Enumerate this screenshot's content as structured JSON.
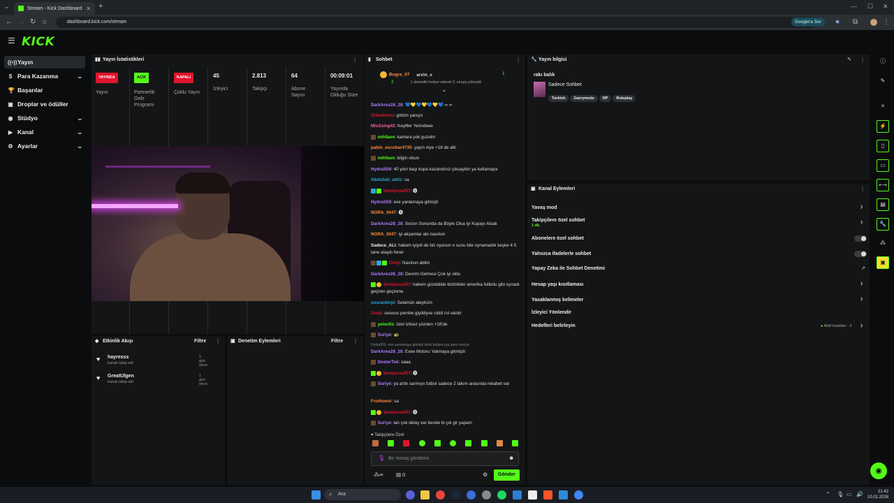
{
  "browser": {
    "tab_title": "Stream - Kick Dashboard",
    "url": "dashboard.kick.com/stream",
    "google_sor": "Google'a Sor"
  },
  "app": {
    "logo": "KICK"
  },
  "sidebar": {
    "items": [
      {
        "label": "Yayın",
        "icon": "broadcast-icon"
      },
      {
        "label": "Para Kazanma",
        "icon": "money-icon"
      },
      {
        "label": "Başarılar",
        "icon": "trophy-icon"
      },
      {
        "label": "Droplar ve ödüller",
        "icon": "gift-icon"
      },
      {
        "label": "Stüdyo",
        "icon": "studio-icon"
      },
      {
        "label": "Kanal",
        "icon": "channel-icon"
      },
      {
        "label": "Ayarlar",
        "icon": "gear-icon"
      }
    ]
  },
  "stats": {
    "title": "Yayın İstatistikleri",
    "items": [
      {
        "badge": "YAYINDA",
        "label": "Yayın"
      },
      {
        "badge": "AÇIK",
        "label": "Partnerlik Gelir Programı"
      },
      {
        "badge": "KAPALI",
        "label": "Çoklu Yayın"
      },
      {
        "value": "45",
        "label": "İzleyici"
      },
      {
        "value": "2.813",
        "label": "Takipçi"
      },
      {
        "value": "64",
        "label": "Abone Sayısı"
      },
      {
        "value": "00:09:01",
        "label": "Yayında Olduğu Süre"
      }
    ]
  },
  "activity": {
    "title": "Etkinlik Akışı",
    "filter": "Filtre",
    "items": [
      {
        "name": "hayresss",
        "sub": "kanalı takip etti",
        "time": "1 gün önce"
      },
      {
        "name": "GreatUlgen",
        "sub": "kanalı takip etti",
        "time": "1 gün önce"
      }
    ]
  },
  "moderation": {
    "title": "Denetim Eylemleri",
    "filter": "Filtre"
  },
  "chat": {
    "title": "Sohbet",
    "pinned_user1": "Bugra_07",
    "pinned_count1": "2",
    "pinned_user2": "arvin_x",
    "pinned_count2": "1",
    "pinned_note": "1 abonelik hediye ederek 3. sıraya yükseldi",
    "messages": [
      {
        "user": "DarkAres28_28",
        "color": "#b07cff",
        "text": "💙💛💙💛💙💛💙 ∞ ∞"
      },
      {
        "user": "Orbodorbu",
        "color": "#e0142e",
        "text": "götüm yanıyo"
      },
      {
        "user": "MisSsing42",
        "color": "#ff5ca8",
        "text": "Keyifler Yerindeee"
      },
      {
        "user": "mihfaon",
        "color": "#53fc18",
        "text": "kamera yok guzelm"
      },
      {
        "user": "pablo_escobar4735",
        "color": "#ff8a3c",
        "text": "yayın niye +18 de abi"
      },
      {
        "user": "mihfaon",
        "color": "#53fc18",
        "text": "bilgin olsun"
      },
      {
        "user": "HydraS59",
        "color": "#b07cff",
        "text": "40 yılın başı kupa kazandınız çıksaydın ya kutlamaya"
      },
      {
        "user": "Abdullah_abiiz",
        "color": "#2aa8d8",
        "text": "sa"
      },
      {
        "user": "Semiyusuf57",
        "color": "#e0142e",
        "text": "🅢"
      },
      {
        "user": "HydraS59",
        "color": "#b07cff",
        "text": "exe yanlamaya gitmişti"
      },
      {
        "user": "NORA_0047",
        "color": "#ff8a3c",
        "text": "🅢"
      },
      {
        "user": "DarkAres28_28",
        "color": "#b07cff",
        "text": "Sezon Sonunda da Böyle Olsa iyi Kupayı Alsak"
      },
      {
        "user": "NORA_0047",
        "color": "#ff8a3c",
        "text": "iyi akşamlar abi nasılsın"
      },
      {
        "user": "Sadece_ALI",
        "color": "#eeeeee",
        "text": "hakem iyiydi de biz oyunun o sunu bile oynamadık keşke 4 5 tane ataydı fener"
      },
      {
        "user": "Gneji",
        "color": "#e0142e",
        "text": "Nasılsın ablim"
      },
      {
        "user": "DarkAres28_28",
        "color": "#b07cff",
        "text": "Devrim Gelmesi Çok iyi oldu"
      },
      {
        "user": "Semiyusuf57",
        "color": "#e0142e",
        "text": "hakem güzeldide bizimkiler amerika futbolu gibi oynadı geçiren geçirene"
      },
      {
        "user": "osurankirpi",
        "color": "#2aa8d8",
        "text": "Selamün aleyküm"
      },
      {
        "user": "Gneji",
        "color": "#e0142e",
        "text": "oooooo pembe giyildiyse ciddi rol vardır"
      },
      {
        "user": "yeisnfiz",
        "color": "#53fc18",
        "text": "özel izlicez yüzden +18'de"
      },
      {
        "user": "Suriye",
        "color": "#b07cff",
        "text": "🐢"
      },
      {
        "user": "DarkAres28_28",
        "color": "#b07cff",
        "text": "Exee Motoru Yakmaya gitmiştir"
      },
      {
        "user": "DexterTek",
        "color": "#b07cff",
        "text": "saaa"
      },
      {
        "user": "Semiyusuf57",
        "color": "#e0142e",
        "text": "🅢"
      },
      {
        "user": "Suriye",
        "color": "#b07cff",
        "text": "ya artık sarmıyo futbol sadece 2 takım arasında rekabet var"
      },
      {
        "user": "Frothomir",
        "color": "#ff8a3c",
        "text": "sa"
      },
      {
        "user": "Semiyusuf57",
        "color": "#e0142e",
        "text": "🅢"
      },
      {
        "user": "Suriye",
        "color": "#b07cff",
        "text": "lan çok delay var bende bi çık gir yapam"
      }
    ],
    "reply_note": "Hydra559: exe yanlamaya gitmişti isimli kullanıcıya yanıt veriyor",
    "followers_only": "Takipçilere Özel",
    "input_placeholder": "Bir mesaj gönderin",
    "points": "0",
    "send": "Gönder"
  },
  "stream_info": {
    "title": "Yayın bilgisi",
    "stream_title": "rakı balık",
    "category": "Sadece Sohbet",
    "tags": [
      "Turkish",
      "Garrymods",
      "RP",
      "Roleplay"
    ]
  },
  "channel_actions": {
    "title": "Kanal Eylemleri",
    "items": [
      {
        "label": "Yavaş mod",
        "type": "chevron"
      },
      {
        "label": "Takipçilere özel sohbet",
        "sub": "1 dk.",
        "type": "chevron"
      },
      {
        "label": "Abonelere özel sohbet",
        "type": "toggle"
      },
      {
        "label": "Yalnızca ifadelerle sohbet",
        "type": "toggle"
      },
      {
        "label": "Yapay Zeka ile Sohbet Denetimi",
        "type": "external"
      },
      {
        "label": "Hesap yaşı kısıtlaması",
        "type": "chevron"
      },
      {
        "label": "Yasaklanmış kelimeler",
        "type": "chevron"
      },
      {
        "label": "İzleyici Yönlendir",
        "type": "none"
      },
      {
        "label": "Hedefleri belirleyin",
        "type": "chevron",
        "note": "Aktif hedefler - 2"
      }
    ]
  },
  "taskbar": {
    "search": "Ara",
    "time": "21:42",
    "date": "10.01.2026"
  }
}
